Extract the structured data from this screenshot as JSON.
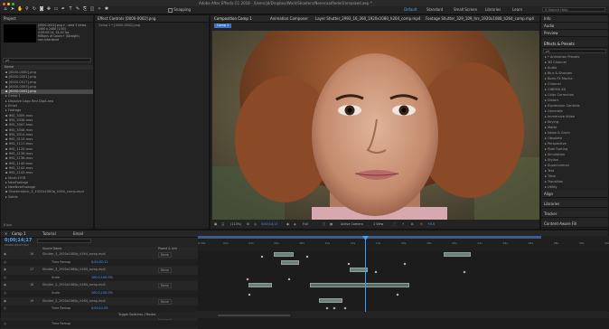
{
  "window": {
    "title": "Adobe After Effects CC 2018 - /Users/jd/Dropbox/Work/Shooters/Nenecaa/Rede/Unmasked.aep *"
  },
  "toolbar": {
    "snapping_label": "Snapping",
    "workspaces": [
      "Default",
      "Standard",
      "Small Screen",
      "Libraries",
      "Learn"
    ],
    "active_workspace": "Default",
    "search_placeholder": "Search Help"
  },
  "project": {
    "tab": "Project",
    "info_lines": [
      "[0000-0002].png ▾ , used 3 times",
      "1060 x 2480 (1.00)",
      "0:00:00:14, 24.00 fps",
      "Millions of Colors+ (Straight)",
      "non-interlaced"
    ],
    "search_placeholder": "ρ▾",
    "column_name": "Name",
    "items": [
      {
        "name": "[0000-0000].png",
        "selected": false
      },
      {
        "name": "[0000-0001].png",
        "selected": false
      },
      {
        "name": "[0000-0017].png",
        "selected": false
      },
      {
        "name": "[0000-0003].png",
        "selected": false
      },
      {
        "name": "[0000-0002].png",
        "selected": true
      },
      {
        "name": "Comp 1",
        "selected": false
      },
      {
        "name": "Dissolve Logo Red Digit.aep",
        "selected": false
      },
      {
        "name": "Email",
        "selected": false
      },
      {
        "name": "Footage",
        "selected": false
      },
      {
        "name": "IMG_3309.mov",
        "selected": false
      },
      {
        "name": "IMG_3336.mov",
        "selected": false
      },
      {
        "name": "IMG_3347.mov",
        "selected": false
      },
      {
        "name": "IMG_3348.mov",
        "selected": false
      },
      {
        "name": "IMG_3314.mov",
        "selected": false
      },
      {
        "name": "IMG_3115.mov",
        "selected": false
      },
      {
        "name": "IMG_1117.mov",
        "selected": false
      },
      {
        "name": "IMG_1120.mov",
        "selected": false
      },
      {
        "name": "IMG_1136.mov",
        "selected": false
      },
      {
        "name": "IMG_1138.mov",
        "selected": false
      },
      {
        "name": "IMG_1140.mov",
        "selected": false
      },
      {
        "name": "IMG_1142.mov",
        "selected": false
      },
      {
        "name": "IMG_1143.mov",
        "selected": false
      },
      {
        "name": "Music1978",
        "selected": false
      },
      {
        "name": "NewFootage",
        "selected": false
      },
      {
        "name": "NewNewFootage",
        "selected": false
      },
      {
        "name": "Shutterstock_3_1920x1080p_h264_comp.mp4",
        "selected": false
      },
      {
        "name": "Solids",
        "selected": false
      }
    ],
    "footer": "8 bpc"
  },
  "effect_controls": {
    "tab": "Effect Controls [0000-0002].png",
    "subtitle": "Comp 1 • [0000-0002].png"
  },
  "viewer": {
    "tabs": [
      {
        "label": "Composition Comp 1",
        "active": true
      },
      {
        "label": "Animation Composer",
        "active": false
      },
      {
        "label": "Layer Shutter_2993_16_360_1920x1080_h264_comp.mp4",
        "active": false
      },
      {
        "label": "Footage Shutter_329_109_hrs_1920x1080_h264_comp.mp4",
        "active": false
      }
    ],
    "comp_chip": "Comp 1",
    "zoom": "(113%)",
    "timecode": "0;00;14;17",
    "resolution": "Full",
    "camera": "Active Camera",
    "view": "1 View",
    "exposure": "+0.0"
  },
  "right_panel": {
    "top_items": [
      "Info",
      "Audio",
      "Preview"
    ],
    "effects_title": "Effects & Presets",
    "search_placeholder": "ρ▾",
    "effects": [
      "* Animation Presets",
      "3D Channel",
      "Audio",
      "Blur & Sharpen",
      "Boris FX Mocha",
      "Channel",
      "CINEMA 4D",
      "Color Correction",
      "Distort",
      "Expression Controls",
      "Generate",
      "Immersive Video",
      "Keying",
      "Matte",
      "Noise & Grain",
      "Obsolete",
      "Perspective",
      "Pixel Sorting",
      "Simulation",
      "Stylize",
      "Superluminal",
      "Text",
      "Time",
      "Transition",
      "Utility"
    ],
    "bottom_items": [
      "Align",
      "Libraries",
      "Tracker",
      "Content-Aware Fill"
    ]
  },
  "timeline": {
    "tabs": [
      "Comp 1",
      "Tutorial",
      "Email"
    ],
    "timecode": "0;00;14;17",
    "fps": "00449 (29.97 fps)",
    "col_headers": {
      "source": "Source Name",
      "parent": "Parent & Link"
    },
    "ruler": [
      "0:00s",
      "02s",
      "04s",
      "06s",
      "08s",
      "10s",
      "12s",
      "14s",
      "16s",
      "18s",
      "20s",
      "22s",
      "24s",
      "26s",
      "28s",
      "30s",
      "32s"
    ],
    "layers": [
      {
        "num": "16",
        "name": "Shutter_3_1920x1080p_h264_comp.mp4",
        "parent": "None",
        "prop": false
      },
      {
        "num": "",
        "name": "Time Remap",
        "value": "0;00;02;11",
        "parent": "",
        "prop": true
      },
      {
        "num": "17",
        "name": "Shutter_3_1920x1080p_h264_comp.mp4",
        "parent": "None",
        "prop": false
      },
      {
        "num": "",
        "name": "Scale",
        "value": "100.0,100.0%",
        "parent": "",
        "prop": true
      },
      {
        "num": "18",
        "name": "Shutter_2_1920x1080p_h264_comp.mp4",
        "parent": "None",
        "prop": false
      },
      {
        "num": "",
        "name": "Scale",
        "value": "100.0,100.0%",
        "parent": "",
        "prop": true
      },
      {
        "num": "19",
        "name": "Shutter_2_1920x1080p_h264_comp.mp4",
        "parent": "None",
        "prop": false
      },
      {
        "num": "",
        "name": "Time Remap",
        "value": "0;00;11;05",
        "parent": "",
        "prop": true
      },
      {
        "num": "20",
        "name": "Shutter_1_1920x1080p_h264_comp.mp4",
        "parent": "None",
        "prop": false
      },
      {
        "num": "",
        "name": "Time Remap",
        "value": "",
        "parent": "",
        "prop": true
      }
    ],
    "footer": "Toggle Switches / Modes"
  },
  "colors": {
    "accent": "#4aa3ff",
    "selection": "#4a4a4a",
    "clip": "#6d7f7b",
    "playhead": "#3aa0ff"
  }
}
